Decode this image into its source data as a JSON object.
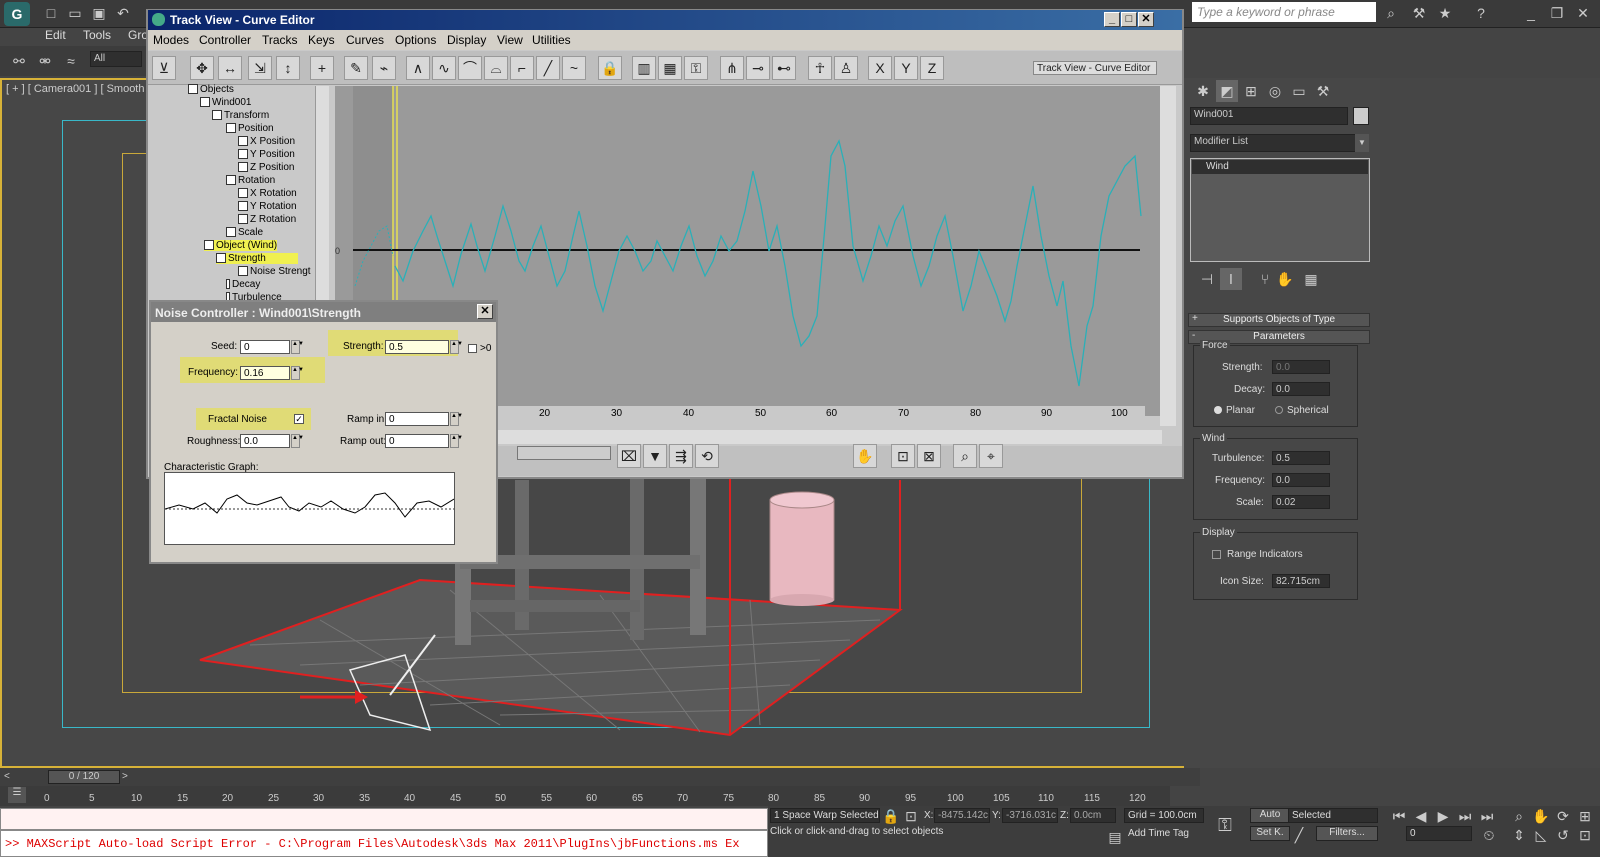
{
  "app": {
    "menus": [
      "Edit",
      "Tools",
      "Gro"
    ],
    "search_placeholder": "Type a keyword or phrase",
    "selection_filter": "All"
  },
  "viewport": {
    "label": "[ + ] [ Camera001 ] [ Smooth"
  },
  "trackview": {
    "title": "Track View - Curve Editor",
    "menus": [
      "Modes",
      "Controller",
      "Tracks",
      "Keys",
      "Curves",
      "Options",
      "Display",
      "View",
      "Utilities"
    ],
    "name_field": "Track View - Curve Editor",
    "tree": [
      {
        "label": "Objects"
      },
      {
        "label": "Wind001"
      },
      {
        "label": "Transform"
      },
      {
        "label": "Position"
      },
      {
        "label": "X Position"
      },
      {
        "label": "Y Position"
      },
      {
        "label": "Z Position"
      },
      {
        "label": "Rotation"
      },
      {
        "label": "X Rotation"
      },
      {
        "label": "Y Rotation"
      },
      {
        "label": "Z Rotation"
      },
      {
        "label": "Scale"
      },
      {
        "label": "Object (Wind)"
      },
      {
        "label": "Strength"
      },
      {
        "label": "Noise Strengt"
      },
      {
        "label": "Decay"
      },
      {
        "label": "Turbulence"
      }
    ],
    "zero_label": "0",
    "ruler": [
      "20",
      "30",
      "40",
      "50",
      "60",
      "70",
      "80",
      "90",
      "100"
    ]
  },
  "noise": {
    "title": "Noise Controller : Wind001\\Strength",
    "seed_label": "Seed:",
    "seed_value": "0",
    "strength_label": "Strength:",
    "strength_value": "0.5",
    "gt0_label": ">0",
    "frequency_label": "Frequency:",
    "frequency_value": "0.16",
    "fractal_label": "Fractal Noise",
    "rampin_label": "Ramp in:",
    "rampin_value": "0",
    "roughness_label": "Roughness:",
    "roughness_value": "0.0",
    "rampout_label": "Ramp out:",
    "rampout_value": "0",
    "graph_label": "Characteristic Graph:"
  },
  "cmd": {
    "object_name": "Wind001",
    "modifier_list": "Modifier List",
    "stack_item": "Wind",
    "rollout_supports": "Supports Objects of Type",
    "rollout_params": "Parameters",
    "force_title": "Force",
    "strength_label": "Strength:",
    "strength_value": "0.0",
    "decay_label": "Decay:",
    "decay_value": "0.0",
    "planar_label": "Planar",
    "spherical_label": "Spherical",
    "wind_title": "Wind",
    "turbulence_label": "Turbulence:",
    "turbulence_value": "0.5",
    "frequency_label": "Frequency:",
    "frequency_value": "0.0",
    "scale_label": "Scale:",
    "scale_value": "0.02",
    "display_title": "Display",
    "range_label": "Range Indicators",
    "iconsize_label": "Icon Size:",
    "iconsize_value": "82.715cm"
  },
  "timeline": {
    "frame": "0 / 120",
    "ticks": [
      "0",
      "5",
      "10",
      "15",
      "20",
      "25",
      "30",
      "35",
      "40",
      "45",
      "50",
      "55",
      "60",
      "65",
      "70",
      "75",
      "80",
      "85",
      "90",
      "95",
      "100",
      "105",
      "110",
      "115",
      "120"
    ]
  },
  "status": {
    "selected": "1 Space Warp Selected",
    "prompt": "Click or click-and-drag to select objects",
    "x_label": "X:",
    "x_value": "-8475.142c",
    "y_label": "Y:",
    "y_value": "-3716.031c",
    "z_label": "Z:",
    "z_value": "0.0cm",
    "grid": "Grid = 100.0cm",
    "add_time_tag": "Add Time Tag",
    "auto": "Auto",
    "setk": "Set K.",
    "selected_dd": "Selected",
    "filters": "Filters...",
    "frame_field": "0"
  },
  "script_error": ">> MAXScript Auto-load Script Error - C:\\Program Files\\Autodesk\\3ds Max 2011\\PlugIns\\jbFunctions.ms Ex",
  "colors": {
    "curve": "#2ab0b8",
    "highlight": "#e6df52",
    "title_bar": "#0a246a"
  }
}
